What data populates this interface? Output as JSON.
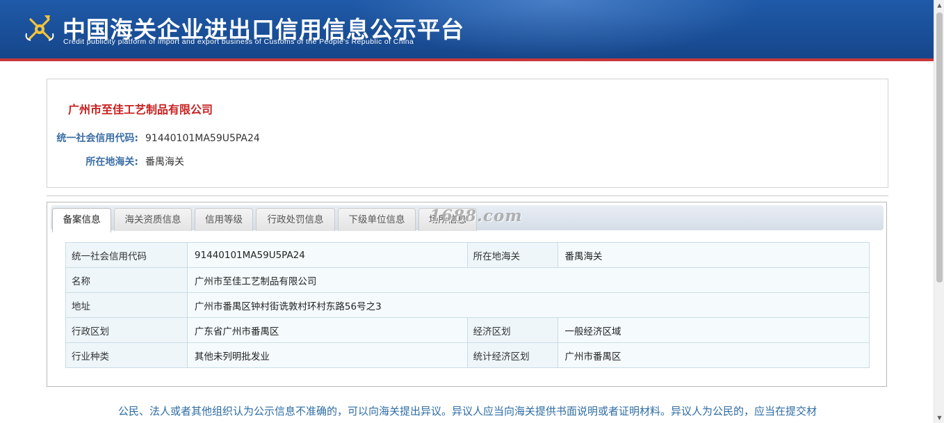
{
  "header": {
    "title_cn": "中国海关企业进出口信用信息公示平台",
    "title_en": "Credit publicity platform of import and export business of Customs of the People's Republic of China",
    "logo_icon": "customs-emblem-icon",
    "brand_color": "#1a4f98",
    "accent_color": "#c9373a"
  },
  "summary": {
    "company_name": "广州市至佳工艺制品有限公司",
    "credit_code_label": "统一社会信用代码:",
    "credit_code_value": "91440101MA59U5PA24",
    "customs_label": "所在地海关:",
    "customs_value": "番禺海关"
  },
  "tabs": [
    {
      "label": "备案信息",
      "active": true
    },
    {
      "label": "海关资质信息",
      "active": false
    },
    {
      "label": "信用等级",
      "active": false
    },
    {
      "label": "行政处罚信息",
      "active": false
    },
    {
      "label": "下级单位信息",
      "active": false
    },
    {
      "label": "场所信息",
      "active": false
    }
  ],
  "watermark": "1688.com",
  "info_table": {
    "credit_code_label": "统一社会信用代码",
    "credit_code_value": "91440101MA59U5PA24",
    "customs_label": "所在地海关",
    "customs_value": "番禺海关",
    "name_label": "名称",
    "name_value": "广州市至佳工艺制品有限公司",
    "address_label": "地址",
    "address_value": "广州市番禺区钟村街诜敦村环村东路56号之3",
    "admin_region_label": "行政区划",
    "admin_region_value": "广东省广州市番禺区",
    "econ_region_label": "经济区划",
    "econ_region_value": "一般经济区域",
    "industry_label": "行业种类",
    "industry_value": "其他未列明批发业",
    "stat_region_label": "统计经济区划",
    "stat_region_value": "广州市番禺区"
  },
  "notice": "公民、法人或者其他组织认为公示信息不准确的，可以向海关提出异议。异议人应当向海关提供书面说明或者证明材料。异议人为公民的，应当在提交材"
}
